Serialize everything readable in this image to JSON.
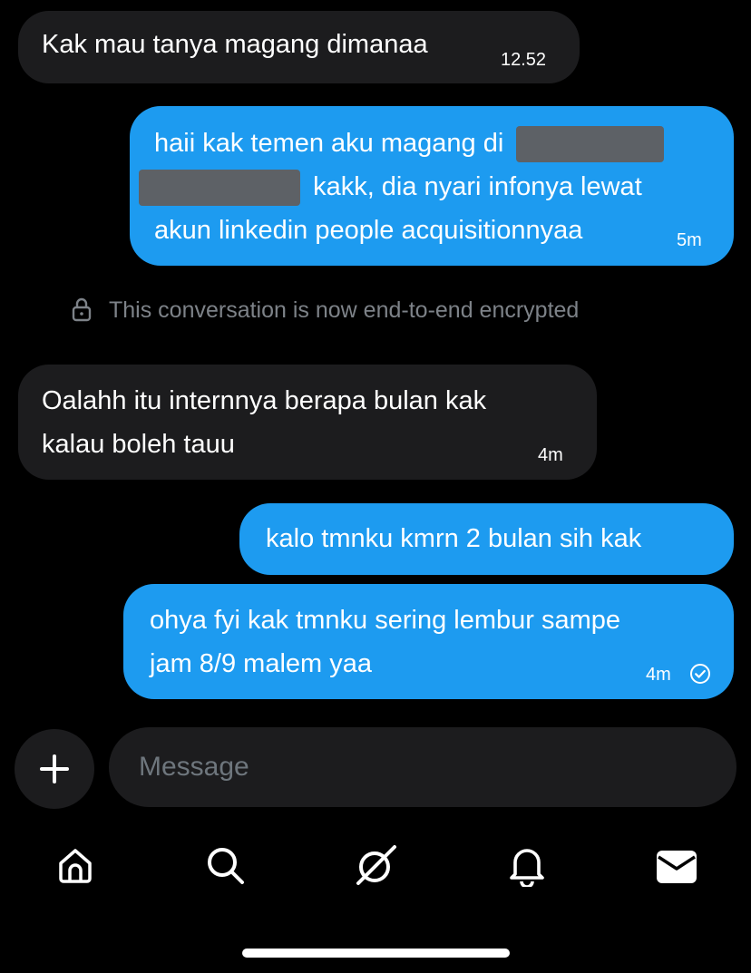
{
  "messages": [
    {
      "side": "in",
      "text": "Kak mau tanya magang dimanaa",
      "time": "12.52"
    },
    {
      "side": "out",
      "line1": "haii kak temen aku magang di",
      "line2": "kakk, dia nyari infonya lewat",
      "line3": "akun linkedin people acquisitionnyaa",
      "time": "5m"
    },
    {
      "side": "in",
      "line1": "Oalahh itu internnya berapa bulan kak",
      "line2": "kalau boleh tauu",
      "time": "4m"
    },
    {
      "side": "out",
      "text": "kalo tmnku kmrn 2 bulan sih kak"
    },
    {
      "side": "out",
      "line1": "ohya fyi kak tmnku sering lembur sampe",
      "line2": "jam 8/9 malem yaa",
      "time": "4m"
    }
  ],
  "system_notice": "This conversation is now end-to-end encrypted",
  "composer": {
    "placeholder": "Message"
  },
  "icons": {
    "lock": "lock-icon",
    "plus": "plus-icon",
    "read": "read-check-icon",
    "home": "home-icon",
    "search": "search-icon",
    "grok": "grok-icon",
    "notifications": "bell-icon",
    "messages": "envelope-icon"
  },
  "colors": {
    "accent": "#1d9bf0",
    "incoming_bubble": "#1c1c1e",
    "background": "#000000"
  }
}
